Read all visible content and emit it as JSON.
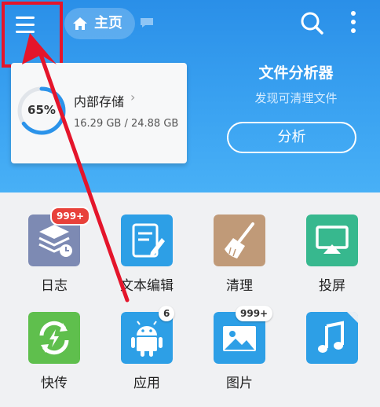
{
  "header": {
    "home_label": "主页",
    "storage": {
      "percent_text": "65%",
      "used_fraction": 0.65,
      "title": "内部存储",
      "size_text": "16.29 GB / 24.88 GB"
    },
    "analyzer": {
      "title": "文件分析器",
      "subtitle": "发现可清理文件",
      "button_label": "分析"
    }
  },
  "grid": {
    "items": [
      {
        "label": "日志",
        "icon": "log-icon",
        "badge": "999+"
      },
      {
        "label": "文本编辑",
        "icon": "text-edit-icon"
      },
      {
        "label": "清理",
        "icon": "broom-icon"
      },
      {
        "label": "投屏",
        "icon": "cast-icon"
      },
      {
        "label": "快传",
        "icon": "transfer-icon"
      },
      {
        "label": "应用",
        "icon": "android-icon",
        "badge": "6"
      },
      {
        "label": "图片",
        "icon": "image-icon",
        "badge": "999+"
      },
      {
        "label": "",
        "icon": "music-icon"
      }
    ]
  },
  "colors": {
    "header": "#2f95ec",
    "annotation_red": "#e4152b",
    "badge_red": "#e8413a"
  }
}
